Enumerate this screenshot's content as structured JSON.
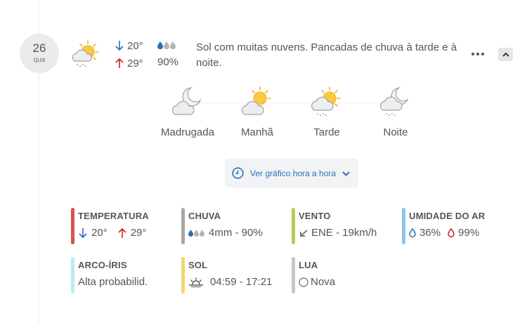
{
  "day": {
    "date": "26",
    "weekday": "qua"
  },
  "summary": {
    "icon": "sun-cloud-rain-icon",
    "temp_min": "20°",
    "temp_max": "29°",
    "rain_probability": "90%",
    "description": "Sol com muitas nuvens. Pancadas de chuva à tarde e à noite."
  },
  "periods": [
    {
      "label": "Madrugada",
      "icon": "moon-cloud-icon"
    },
    {
      "label": "Manhã",
      "icon": "sun-cloud-icon"
    },
    {
      "label": "Tarde",
      "icon": "sun-cloud-rain-icon"
    },
    {
      "label": "Noite",
      "icon": "moon-cloud-rain-icon"
    }
  ],
  "hourly_button": {
    "label": "Ver gráfico hora a hora",
    "icon": "clock-icon"
  },
  "stats": {
    "temperatura": {
      "title": "TEMPERATURA",
      "min": "20°",
      "max": "29°",
      "color": "#d9534f"
    },
    "chuva": {
      "title": "CHUVA",
      "value": "4mm - 90%",
      "color": "#a6a6a6"
    },
    "vento": {
      "title": "VENTO",
      "value": "ENE - 19km/h",
      "color": "#b5cc5a"
    },
    "umidade": {
      "title": "UMIDADE DO AR",
      "min": "36%",
      "max": "99%",
      "color": "#8fc3ec"
    },
    "arco_iris": {
      "title": "ARCO-ÍRIS",
      "value": "Alta probabilid.",
      "color": "#b8ecf0"
    },
    "sol": {
      "title": "SOL",
      "value": "04:59 - 17:21",
      "color": "#f2d86a"
    },
    "lua": {
      "title": "LUA",
      "value": "Nova",
      "color": "#c4c6c9"
    }
  },
  "colors": {
    "accent_blue": "#2a6ebb",
    "max_red": "#d0221e",
    "sun_yellow": "#f7c843",
    "drop_blue": "#2a6ebb",
    "drop_grey": "#b5b5b5"
  }
}
